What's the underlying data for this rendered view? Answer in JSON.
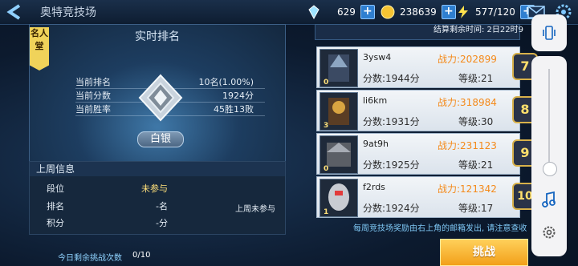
{
  "header": {
    "title": "奥特竞技场",
    "diamonds": "629",
    "coins": "238639",
    "energy": "577/120",
    "plus_label": "+"
  },
  "panel": {
    "title": "实时排名",
    "fame_label": "名人堂",
    "stats": [
      {
        "label": "当前排名",
        "value": "10名(1.00%)"
      },
      {
        "label": "当前分数",
        "value": "1924分"
      },
      {
        "label": "当前胜率",
        "value": "45胜13败"
      }
    ],
    "tier": "白银"
  },
  "last_week": {
    "title": "上周信息",
    "rows": [
      {
        "label": "段位",
        "value": "未参与"
      },
      {
        "label": "排名",
        "value": "-名"
      },
      {
        "label": "积分",
        "value": "-分"
      }
    ],
    "note": "上周未参与"
  },
  "challenges": {
    "label": "今日剩余挑战次数",
    "value": "0/10"
  },
  "countdown": "结算剩余时间: 2日22时9",
  "players": [
    {
      "name": "3ysw4",
      "power": "战力:202899",
      "score": "分数:1944分",
      "grade": "等级:21",
      "rank": "7",
      "level": "0"
    },
    {
      "name": "li6km",
      "power": "战力:318984",
      "score": "分数:1931分",
      "grade": "等级:30",
      "rank": "8",
      "level": "3"
    },
    {
      "name": "9at9h",
      "power": "战力:231123",
      "score": "分数:1925分",
      "grade": "等级:21",
      "rank": "9",
      "level": "0"
    },
    {
      "name": "f2rds",
      "power": "战力:121342",
      "score": "分数:1924分",
      "grade": "等级:17",
      "rank": "10",
      "level": "1"
    }
  ],
  "notice": "每周竞技场奖励由右上角的邮箱发出, 请注意查收",
  "challenge_button": "挑战",
  "colors": {
    "accent": "#f2a01a",
    "power": "#f48a1b",
    "rank_border": "#d8b14a"
  }
}
